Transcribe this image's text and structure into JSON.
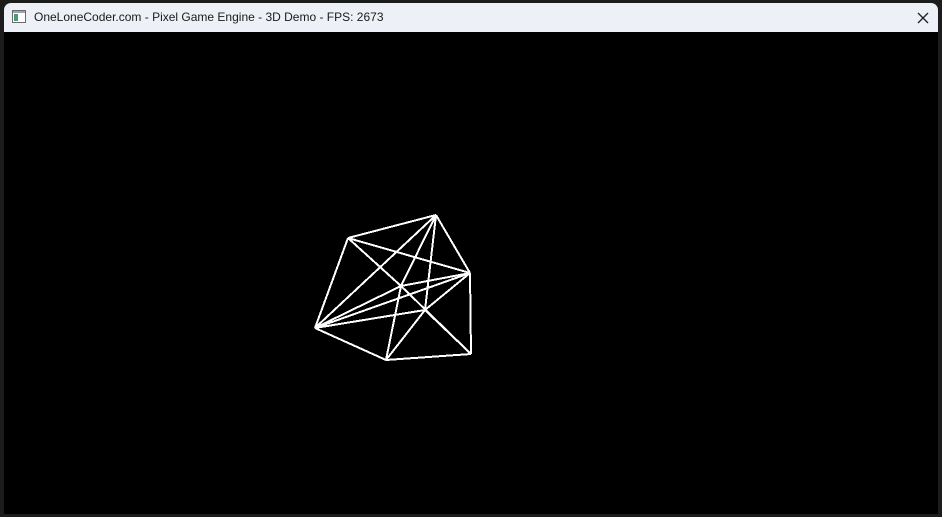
{
  "window": {
    "title": "OneLoneCoder.com - Pixel Game Engine - 3D Demo - FPS: 2673",
    "app_icon": "window-app-icon",
    "close_icon": "close-icon"
  },
  "scene": {
    "background_color": "#000000",
    "line_color": "#ffffff",
    "object": "wireframe-cube"
  }
}
